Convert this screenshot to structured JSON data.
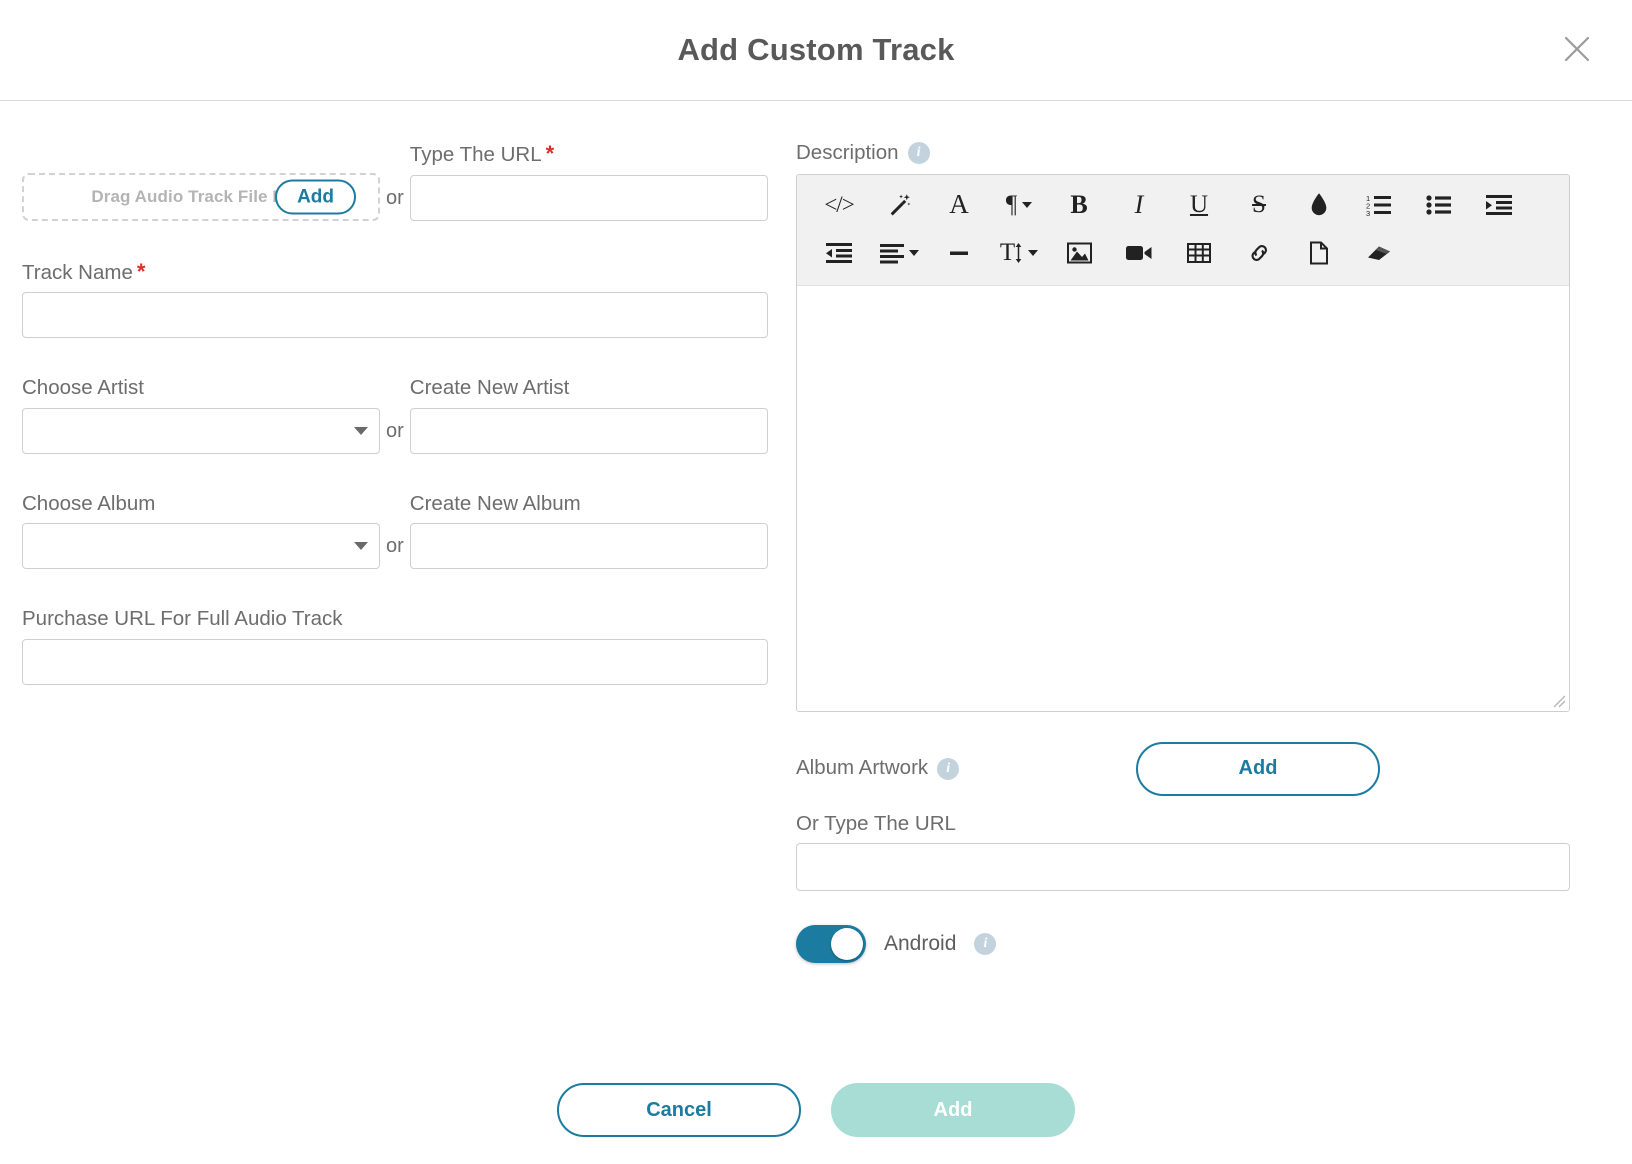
{
  "dialog": {
    "title": "Add Custom Track",
    "close_icon": "close-icon"
  },
  "upload": {
    "dropzone_text": "Drag Audio Track File Here",
    "add_label": "Add",
    "or": "or",
    "url_label": "Type The URL",
    "url_required": "*",
    "url_value": ""
  },
  "track_name": {
    "label": "Track Name",
    "required": "*",
    "value": ""
  },
  "artist": {
    "choose_label": "Choose Artist",
    "selected": "",
    "or": "or",
    "create_label": "Create New Artist",
    "create_value": ""
  },
  "album": {
    "choose_label": "Choose Album",
    "selected": "",
    "or": "or",
    "create_label": "Create New Album",
    "create_value": ""
  },
  "purchase_url": {
    "label": "Purchase URL For Full Audio Track",
    "value": ""
  },
  "description": {
    "label": "Description",
    "info_icon": "info-icon",
    "info_glyph": "i",
    "content": "",
    "toolbar_row1": [
      {
        "name": "code-view-icon",
        "glyph": "</>"
      },
      {
        "name": "magic-wand-icon",
        "glyph": "wand"
      },
      {
        "name": "font-family-icon",
        "glyph": "A"
      },
      {
        "name": "paragraph-format-icon",
        "glyph": "¶",
        "caret": true
      },
      {
        "name": "bold-icon",
        "glyph": "B"
      },
      {
        "name": "italic-icon",
        "glyph": "I"
      },
      {
        "name": "underline-icon",
        "glyph": "U"
      },
      {
        "name": "strikethrough-icon",
        "glyph": "S"
      },
      {
        "name": "text-color-icon",
        "glyph": "drop"
      },
      {
        "name": "ordered-list-icon",
        "glyph": "ol"
      },
      {
        "name": "unordered-list-icon",
        "glyph": "ul"
      },
      {
        "name": "indent-icon",
        "glyph": "indent"
      }
    ],
    "toolbar_row2": [
      {
        "name": "outdent-icon",
        "glyph": "outdent"
      },
      {
        "name": "align-icon",
        "glyph": "align",
        "caret": true
      },
      {
        "name": "horizontal-rule-icon",
        "glyph": "hr"
      },
      {
        "name": "font-size-icon",
        "glyph": "T",
        "caret": true
      },
      {
        "name": "insert-image-icon",
        "glyph": "image"
      },
      {
        "name": "insert-video-icon",
        "glyph": "video"
      },
      {
        "name": "insert-table-icon",
        "glyph": "table"
      },
      {
        "name": "insert-link-icon",
        "glyph": "link"
      },
      {
        "name": "insert-file-icon",
        "glyph": "file"
      },
      {
        "name": "clear-formatting-icon",
        "glyph": "eraser"
      }
    ]
  },
  "album_artwork": {
    "label": "Album Artwork",
    "info_glyph": "i",
    "add_label": "Add",
    "url_label": "Or Type The URL",
    "url_value": ""
  },
  "android": {
    "label": "Android",
    "info_glyph": "i",
    "enabled": true
  },
  "footer": {
    "cancel_label": "Cancel",
    "submit_label": "Add"
  },
  "colors": {
    "accent": "#1b7ba0",
    "submit_disabled": "#a8ddd6",
    "required": "#e02b2b",
    "label_text": "#6d6d6d",
    "toolbar_bg": "#f1f1f1"
  }
}
